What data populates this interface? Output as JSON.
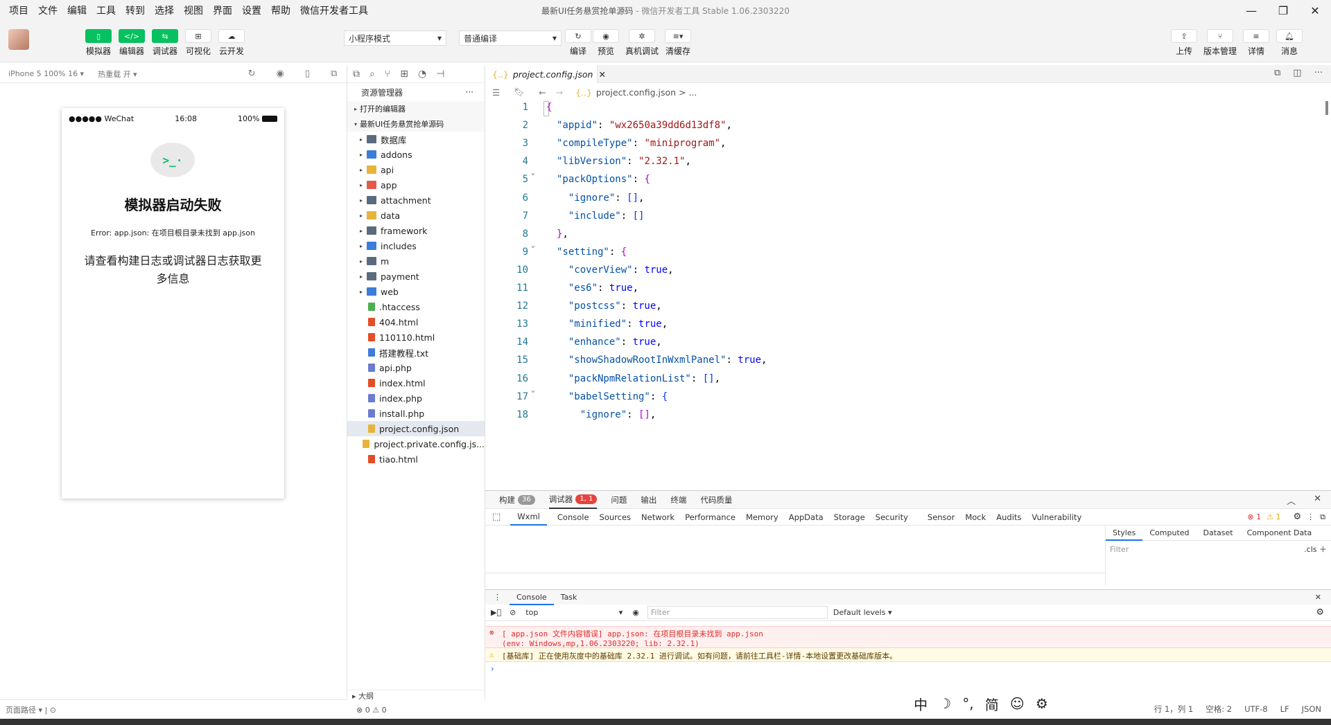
{
  "menu": [
    "项目",
    "文件",
    "编辑",
    "工具",
    "转到",
    "选择",
    "视图",
    "界面",
    "设置",
    "帮助",
    "微信开发者工具"
  ],
  "window_title": {
    "project": "最新UI任务悬赏抢单源码",
    "app": " - 微信开发者工具 Stable 1.06.2303220"
  },
  "toolbar": {
    "left_buttons": [
      {
        "label": "模拟器"
      },
      {
        "label": "编辑器"
      },
      {
        "label": "调试器"
      },
      {
        "label": "可视化"
      },
      {
        "label": "云开发"
      }
    ],
    "mode_select": "小程序模式",
    "compile_select": "普通编译",
    "mid_buttons": [
      {
        "label": "编译"
      },
      {
        "label": "预览"
      },
      {
        "label": "真机调试"
      },
      {
        "label": "清缓存"
      }
    ],
    "right_buttons": [
      {
        "label": "上传"
      },
      {
        "label": "版本管理"
      },
      {
        "label": "详情"
      },
      {
        "label": "消息"
      }
    ]
  },
  "simulator": {
    "device": "iPhone 5 100% 16 ▾",
    "hot_reload": "热重载 开 ▾",
    "status_left": "●●●●● WeChat",
    "time": "16:08",
    "battery": "100%",
    "title": "模拟器启动失败",
    "error": "Error: app.json: 在项目根目录未找到 app.json",
    "hint": "请查看构建日志或调试器日志获取更多信息",
    "footer": "页面路径 ▾  |  ⊙"
  },
  "explorer": {
    "title": "资源管理器",
    "open_editors": "打开的编辑器",
    "project": "最新UI任务悬赏抢单源码",
    "items": [
      {
        "name": "数据库",
        "type": "folder",
        "color": "#5a6b80"
      },
      {
        "name": "addons",
        "type": "folder",
        "color": "#3b7dd8"
      },
      {
        "name": "api",
        "type": "folder",
        "color": "#e8b33a"
      },
      {
        "name": "app",
        "type": "folder",
        "color": "#e25a4c"
      },
      {
        "name": "attachment",
        "type": "folder",
        "color": "#5a6b80"
      },
      {
        "name": "data",
        "type": "folder",
        "color": "#e8b33a"
      },
      {
        "name": "framework",
        "type": "folder",
        "color": "#5a6b80"
      },
      {
        "name": "includes",
        "type": "folder",
        "color": "#3b7dd8"
      },
      {
        "name": "m",
        "type": "folder",
        "color": "#5a6b80"
      },
      {
        "name": "payment",
        "type": "folder",
        "color": "#5a6b80"
      },
      {
        "name": "web",
        "type": "folder",
        "color": "#3b7dd8"
      },
      {
        "name": ".htaccess",
        "type": "file",
        "color": "#4caf50"
      },
      {
        "name": "404.html",
        "type": "file",
        "color": "#e44d26"
      },
      {
        "name": "110110.html",
        "type": "file",
        "color": "#e44d26"
      },
      {
        "name": "搭建教程.txt",
        "type": "file",
        "color": "#3b7dd8"
      },
      {
        "name": "api.php",
        "type": "file",
        "color": "#6a7bd0"
      },
      {
        "name": "index.html",
        "type": "file",
        "color": "#e44d26"
      },
      {
        "name": "index.php",
        "type": "file",
        "color": "#6a7bd0"
      },
      {
        "name": "install.php",
        "type": "file",
        "color": "#6a7bd0"
      },
      {
        "name": "project.config.json",
        "type": "file",
        "color": "#e8b33a"
      },
      {
        "name": "project.private.config.js...",
        "type": "file",
        "color": "#e8b33a"
      },
      {
        "name": "tiao.html",
        "type": "file",
        "color": "#e44d26"
      }
    ],
    "outline": "大纲",
    "status": "⊗ 0 ⚠ 0"
  },
  "editor": {
    "tab": "project.config.json",
    "breadcrumb": "project.config.json > ...",
    "lines": [
      {
        "n": "1",
        "html": "<span class='b1'>{</span>"
      },
      {
        "n": "2",
        "html": "<span class='k'>\"appid\"</span>: <span class='s'>\"wx2650a39dd6d13df8\"</span>,"
      },
      {
        "n": "3",
        "html": "<span class='k'>\"compileType\"</span>: <span class='s'>\"miniprogram\"</span>,"
      },
      {
        "n": "4",
        "html": "<span class='k'>\"libVersion\"</span>: <span class='s'>\"2.32.1\"</span>,"
      },
      {
        "n": "5",
        "html": "<span class='k'>\"packOptions\"</span>: <span class='b1'>{</span>"
      },
      {
        "n": "6",
        "html": "  <span class='k'>\"ignore\"</span>: <span class='b2'>[]</span>,"
      },
      {
        "n": "7",
        "html": "  <span class='k'>\"include\"</span>: <span class='b2'>[]</span>"
      },
      {
        "n": "8",
        "html": "<span class='b1'>}</span>,"
      },
      {
        "n": "9",
        "html": "<span class='k'>\"setting\"</span>: <span class='b1'>{</span>"
      },
      {
        "n": "10",
        "html": "  <span class='k'>\"coverView\"</span>: <span class='v'>true</span>,"
      },
      {
        "n": "11",
        "html": "  <span class='k'>\"es6\"</span>: <span class='v'>true</span>,"
      },
      {
        "n": "12",
        "html": "  <span class='k'>\"postcss\"</span>: <span class='v'>true</span>,"
      },
      {
        "n": "13",
        "html": "  <span class='k'>\"minified\"</span>: <span class='v'>true</span>,"
      },
      {
        "n": "14",
        "html": "  <span class='k'>\"enhance\"</span>: <span class='v'>true</span>,"
      },
      {
        "n": "15",
        "html": "  <span class='k'>\"showShadowRootInWxmlPanel\"</span>: <span class='v'>true</span>,"
      },
      {
        "n": "16",
        "html": "  <span class='k'>\"packNpmRelationList\"</span>: <span class='b2'>[]</span>,"
      },
      {
        "n": "17",
        "html": "  <span class='k'>\"babelSetting\"</span>: <span class='b2'>{</span>"
      },
      {
        "n": "18",
        "html": "    <span class='k'>\"ignore\"</span>: <span class='b1'>[]</span>,"
      }
    ]
  },
  "devtools": {
    "top_tabs": [
      {
        "label": "构建",
        "badge": "36"
      },
      {
        "label": "调试器",
        "badge": "1, 1"
      },
      {
        "label": "问题"
      },
      {
        "label": "输出"
      },
      {
        "label": "终端"
      },
      {
        "label": "代码质量"
      }
    ],
    "panels": [
      "Wxml",
      "Console",
      "Sources",
      "Network",
      "Performance",
      "Memory",
      "AppData",
      "Storage",
      "Security",
      "Sensor",
      "Mock",
      "Audits",
      "Vulnerability"
    ],
    "err_count": "1",
    "warn_count": "1",
    "style_tabs": [
      "Styles",
      "Computed",
      "Dataset",
      "Component Data"
    ],
    "filter_placeholder": "Filter",
    "cls": ".cls",
    "console_tabs": [
      "Console",
      "Task"
    ],
    "context": "top",
    "console_filter": "Filter",
    "levels": "Default levels ▾",
    "error_msg": "[ app.json 文件内容错误] app.json: 在项目根目录未找到 app.json",
    "error_env": "(env: Windows,mp,1.06.2303220; lib: 2.32.1)",
    "warn_msg": "[基础库] 正在使用灰度中的基础库 2.32.1 进行调试。如有问题，请前往工具栏-详情-本地设置更改基础库版本。"
  },
  "status": {
    "pos": "行 1，列 1",
    "space": "空格: 2",
    "enc": "UTF-8",
    "eol": "LF",
    "lang": "JSON"
  },
  "ime": [
    "中",
    "☽",
    "°,",
    "简",
    "☺",
    "⚙"
  ]
}
